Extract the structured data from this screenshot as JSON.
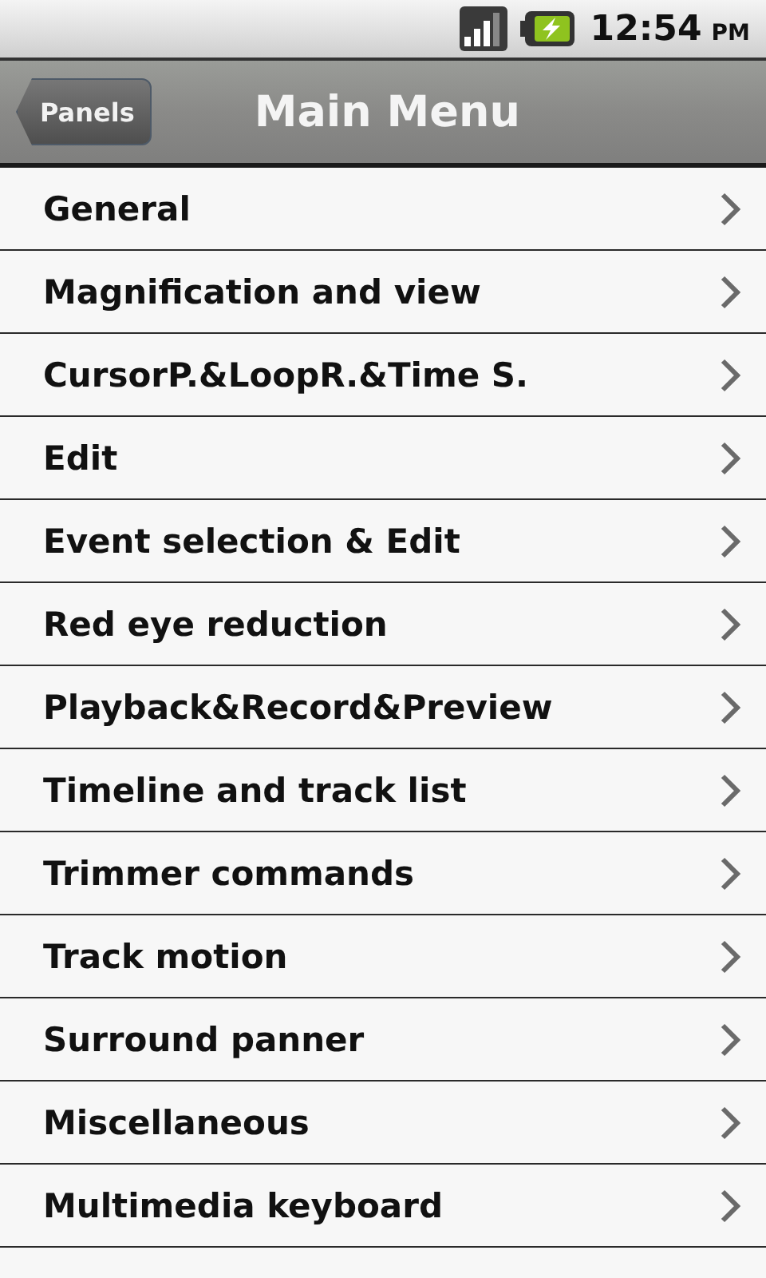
{
  "status_bar": {
    "time": "12:54",
    "ampm": "PM"
  },
  "header": {
    "back_button": "Panels",
    "title": "Main Menu"
  },
  "menu_items": [
    {
      "label": "General"
    },
    {
      "label": "Magnification and view"
    },
    {
      "label": "CursorP.&LoopR.&Time S."
    },
    {
      "label": "Edit"
    },
    {
      "label": "Event selection & Edit"
    },
    {
      "label": "Red eye reduction"
    },
    {
      "label": "Playback&Record&Preview"
    },
    {
      "label": "Timeline and track list"
    },
    {
      "label": "Trimmer commands"
    },
    {
      "label": "Track motion"
    },
    {
      "label": "Surround panner"
    },
    {
      "label": "Miscellaneous"
    },
    {
      "label": "Multimedia keyboard"
    }
  ]
}
